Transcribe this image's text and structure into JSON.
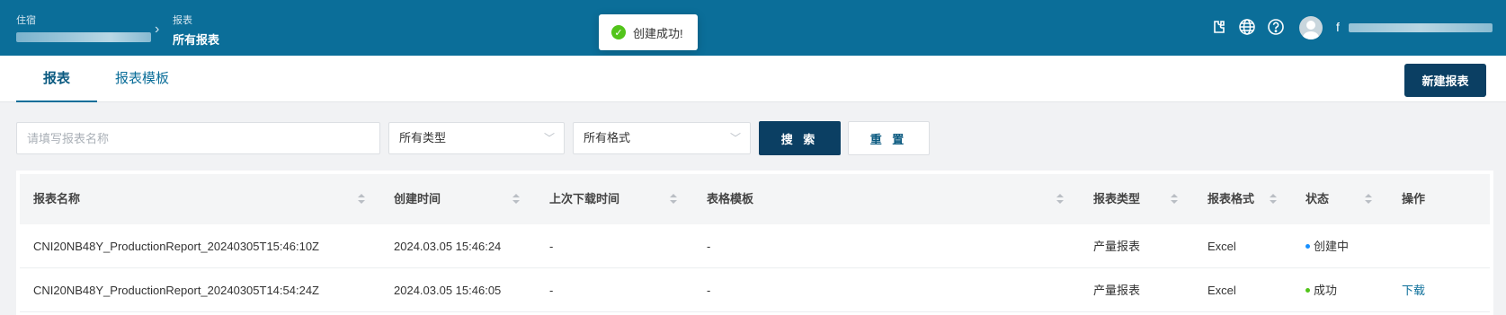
{
  "header": {
    "breadcrumb": [
      {
        "label": "住宿"
      },
      {
        "label": "报表",
        "current": "所有报表"
      }
    ],
    "icons": [
      "puzzle-icon",
      "globe-icon",
      "help-icon"
    ],
    "user_initial": "f",
    "colors": {
      "header_bg": "#0b6e99",
      "primary_button": "#0b3f63"
    }
  },
  "toast": {
    "message": "创建成功!",
    "icon": "check-circle-icon",
    "color": "#52c41a"
  },
  "tabs": [
    {
      "label": "报表",
      "active": true
    },
    {
      "label": "报表模板",
      "active": false
    }
  ],
  "new_button_label": "新建报表",
  "filters": {
    "name_placeholder": "请填写报表名称",
    "name_value": "",
    "type_value": "所有类型",
    "format_value": "所有格式",
    "search_label": "搜 索",
    "reset_label": "重 置"
  },
  "table": {
    "columns": [
      "报表名称",
      "创建时间",
      "上次下载时间",
      "表格模板",
      "报表类型",
      "报表格式",
      "状态",
      "操作"
    ],
    "rows": [
      {
        "name": "CNI20NB48Y_ProductionReport_20240305T15:46:10Z",
        "created": "2024.03.05 15:46:24",
        "last_download": "-",
        "template": "-",
        "type": "产量报表",
        "format": "Excel",
        "status": "创建中",
        "status_color": "#1890ff",
        "action": ""
      },
      {
        "name": "CNI20NB48Y_ProductionReport_20240305T14:54:24Z",
        "created": "2024.03.05 15:46:05",
        "last_download": "-",
        "template": "-",
        "type": "产量报表",
        "format": "Excel",
        "status": "成功",
        "status_color": "#52c41a",
        "action": "下载"
      }
    ]
  }
}
